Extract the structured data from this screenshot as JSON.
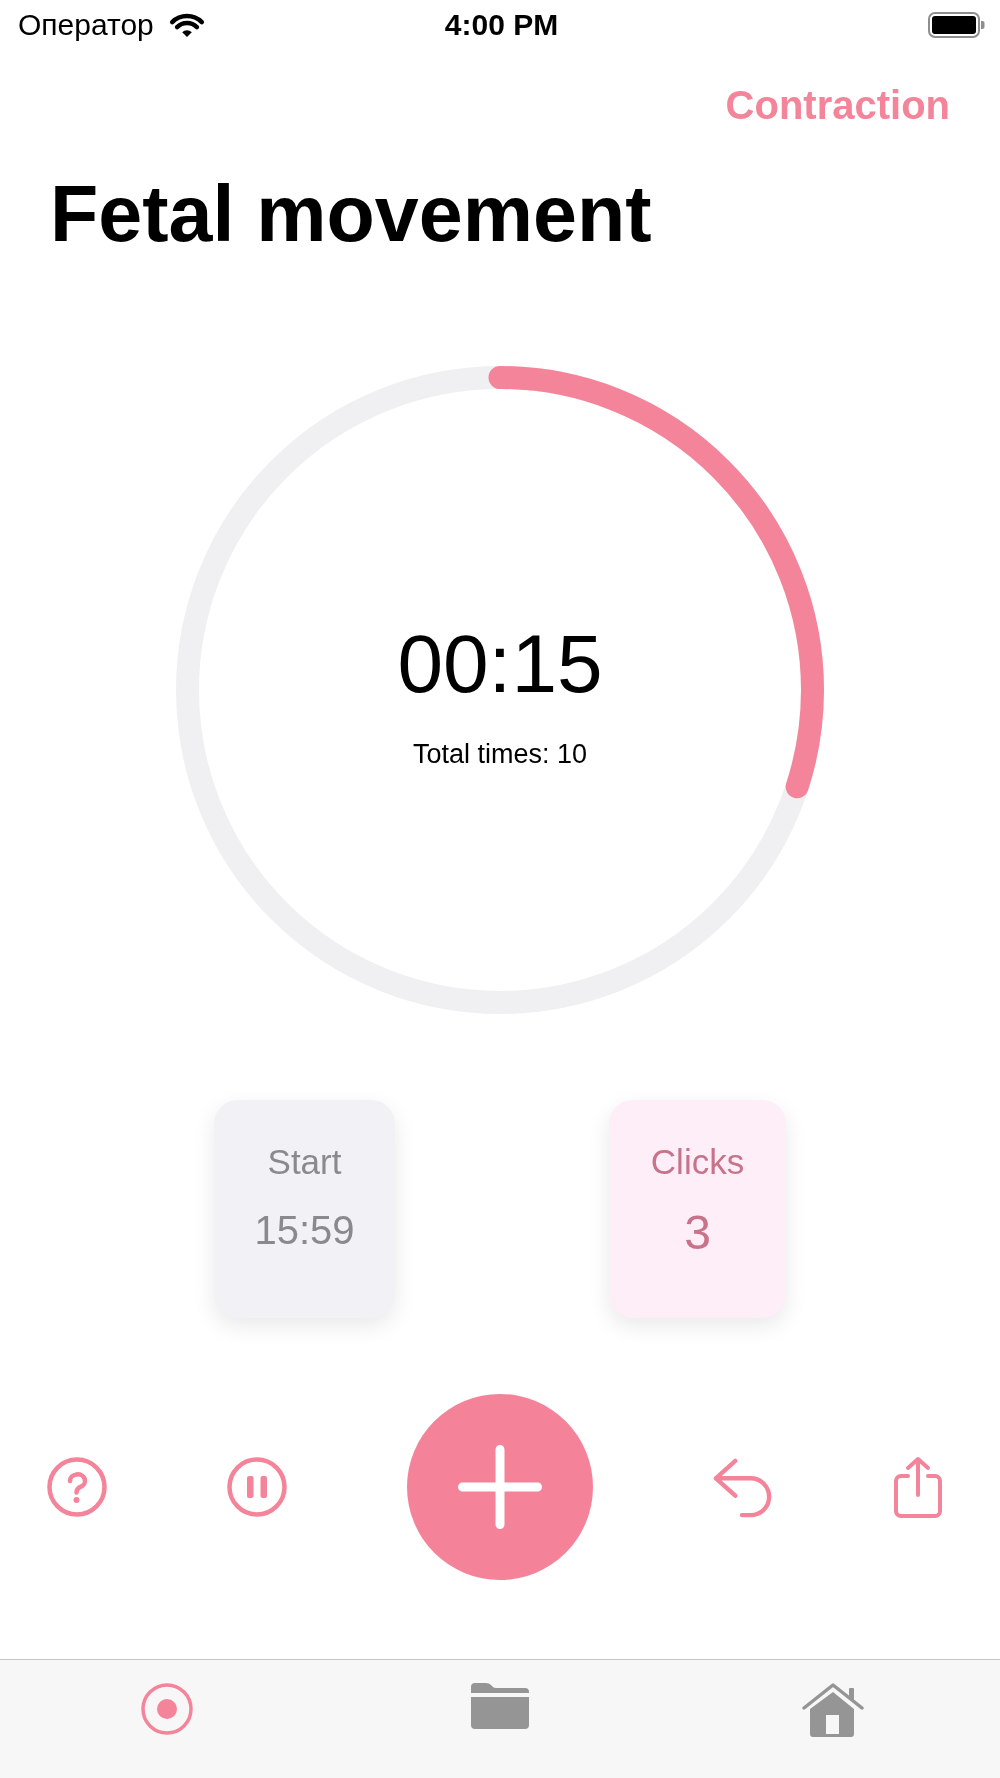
{
  "status_bar": {
    "carrier": "Оператор",
    "time": "4:00 PM"
  },
  "header": {
    "link": "Contraction",
    "title": "Fetal movement"
  },
  "timer": {
    "level": 0.3,
    "elapsed": "00:15",
    "total": "Total times: 10"
  },
  "cards": [
    {
      "kind": "neutral",
      "label": "Start",
      "value": "15:59"
    },
    {
      "kind": "accent",
      "label": "Clicks",
      "value": "3"
    }
  ],
  "tab_bar": {
    "tabs": [
      {
        "selected": true
      },
      {
        "selected": false
      },
      {
        "selected": false
      }
    ]
  }
}
